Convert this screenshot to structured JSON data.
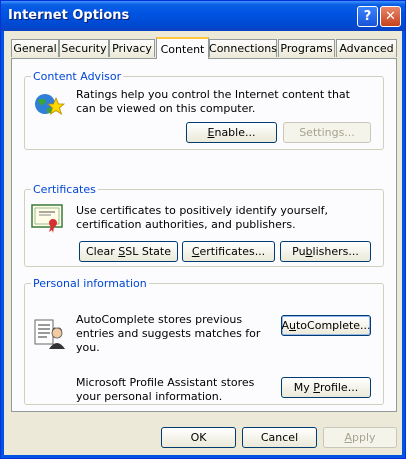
{
  "window": {
    "title": "Internet Options",
    "help_glyph": "?",
    "close_glyph": "✕"
  },
  "tabs": [
    {
      "label": "General"
    },
    {
      "label": "Security"
    },
    {
      "label": "Privacy"
    },
    {
      "label": "Content",
      "active": true
    },
    {
      "label": "Connections"
    },
    {
      "label": "Programs"
    },
    {
      "label": "Advanced"
    }
  ],
  "content_advisor": {
    "label": "Content Advisor",
    "description": "Ratings help you control the Internet content that can be viewed on this computer.",
    "enable_prefix": "",
    "enable_mnemonic": "E",
    "enable_rest": "nable...",
    "settings_label": "Settings..."
  },
  "certificates": {
    "label": "Certificates",
    "description": "Use certificates to positively identify yourself, certification authorities, and publishers.",
    "clear_ssl_pre": "Clear ",
    "clear_ssl_mnemonic": "S",
    "clear_ssl_post": "SL State",
    "certs_pre": "",
    "certs_mnemonic": "C",
    "certs_post": "ertificates...",
    "publishers_pre": "Pu",
    "publishers_mnemonic": "b",
    "publishers_post": "lishers..."
  },
  "personal": {
    "label": "Personal information",
    "autocomplete_text": "AutoComplete stores previous entries and suggests matches for you.",
    "autocomplete_pre": "A",
    "autocomplete_mnemonic": "u",
    "autocomplete_post": "toComplete...",
    "profile_text": "Microsoft Profile Assistant stores your personal information.",
    "profile_pre": "My ",
    "profile_mnemonic": "P",
    "profile_post": "rofile..."
  },
  "footer": {
    "ok": "OK",
    "cancel": "Cancel",
    "apply_mnemonic": "A",
    "apply_post": "pply"
  },
  "colors": {
    "title_bar": "#0054e3",
    "group_label": "#0046d5",
    "dialog_bg": "#ece9d8"
  }
}
